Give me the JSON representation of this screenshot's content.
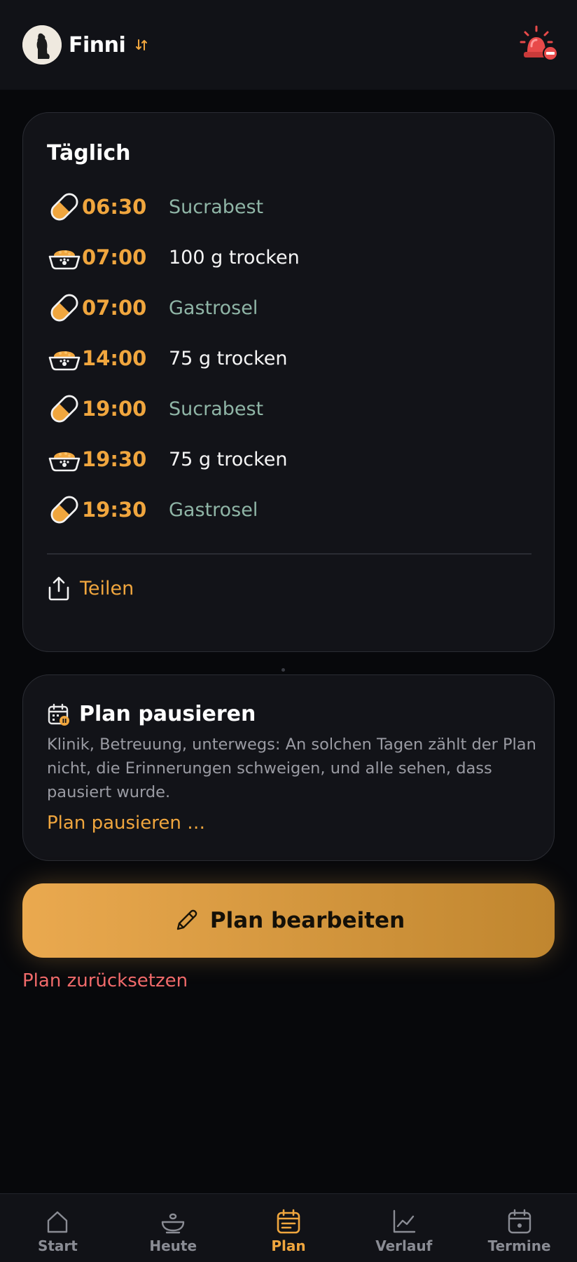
{
  "header": {
    "pet_name": "Finni"
  },
  "daily": {
    "title": "Täglich",
    "rows": [
      {
        "kind": "med",
        "icon": "pill-icon",
        "time": "06:30",
        "label": "Sucrabest"
      },
      {
        "kind": "food",
        "icon": "food-bowl-icon",
        "time": "07:00",
        "label": "100 g trocken"
      },
      {
        "kind": "med",
        "icon": "pill-icon",
        "time": "07:00",
        "label": "Gastrosel"
      },
      {
        "kind": "food",
        "icon": "food-bowl-icon",
        "time": "14:00",
        "label": "75 g trocken"
      },
      {
        "kind": "med",
        "icon": "pill-icon",
        "time": "19:00",
        "label": "Sucrabest"
      },
      {
        "kind": "food",
        "icon": "food-bowl-icon",
        "time": "19:30",
        "label": "75 g trocken"
      },
      {
        "kind": "med",
        "icon": "pill-icon",
        "time": "19:30",
        "label": "Gastrosel"
      }
    ],
    "share_label": "Teilen"
  },
  "pause": {
    "title": "Plan pausieren",
    "description": "Klinik, Betreuung, unterwegs: An solchen Tagen zählt der Plan nicht, die Erinnerungen schweigen, und alle sehen, dass pausiert wurde.",
    "link_label": "Plan pausieren …"
  },
  "actions": {
    "edit_label": "Plan bearbeiten",
    "reset_label": "Plan zurücksetzen"
  },
  "nav": {
    "items": [
      {
        "label": "Start",
        "icon": "home-icon",
        "active": false
      },
      {
        "label": "Heute",
        "icon": "bowl-icon",
        "active": false
      },
      {
        "label": "Plan",
        "icon": "plan-calendar-icon",
        "active": true
      },
      {
        "label": "Verlauf",
        "icon": "chart-icon",
        "active": false
      },
      {
        "label": "Termine",
        "icon": "calendar-icon",
        "active": false
      }
    ]
  },
  "colors": {
    "accent": "#f0a63e",
    "medication_text": "#8fb5a6",
    "danger": "#f06a6a",
    "background": "#07080b",
    "card": "#121318"
  }
}
